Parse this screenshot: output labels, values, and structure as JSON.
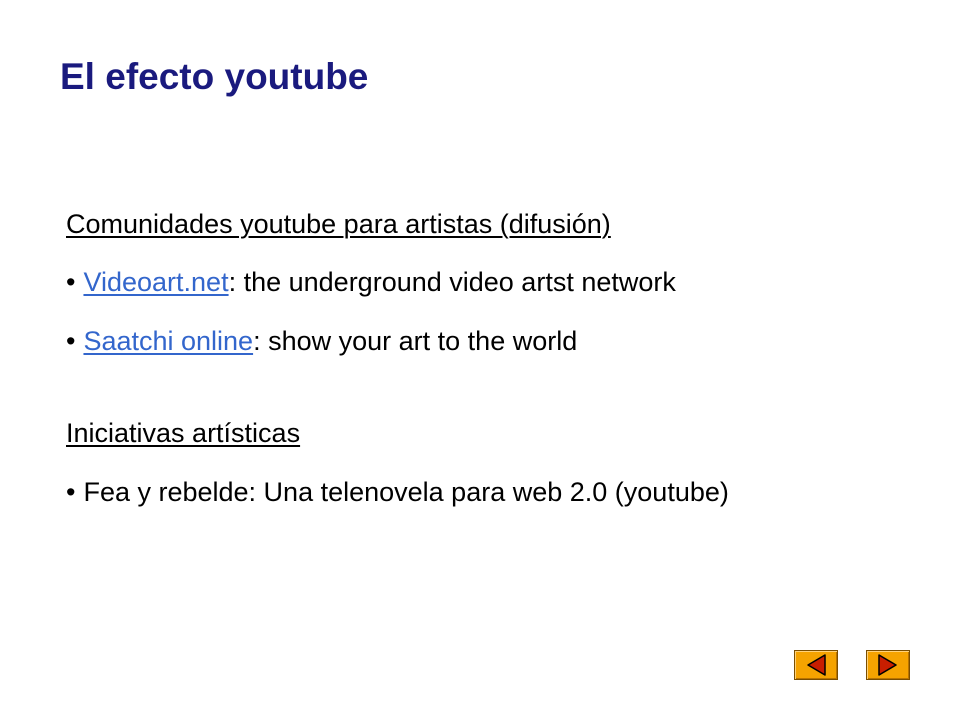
{
  "slide": {
    "title": "El efecto youtube"
  },
  "sections": {
    "comunidades": {
      "heading": "Comunidades youtube para artistas (difusión)",
      "items": [
        {
          "bullet": "•",
          "link_text": "Videoart.net",
          "separator": ":",
          "text": " the underground video artst network"
        },
        {
          "bullet": "•",
          "link_text": "Saatchi online",
          "separator": ":",
          "text": " show your art to the world"
        }
      ]
    },
    "iniciativas": {
      "heading": "Iniciativas artísticas",
      "items": [
        {
          "bullet": "•",
          "text": "Fea y rebelde: Una telenovela para web 2.0 (youtube)"
        }
      ]
    }
  },
  "navigation": {
    "prev_icon": "triangle-left-icon",
    "next_icon": "triangle-right-icon",
    "button_color": "#f5a300"
  },
  "colors": {
    "title": "#1a1a7e",
    "link": "#3366cc",
    "text": "#000000"
  }
}
